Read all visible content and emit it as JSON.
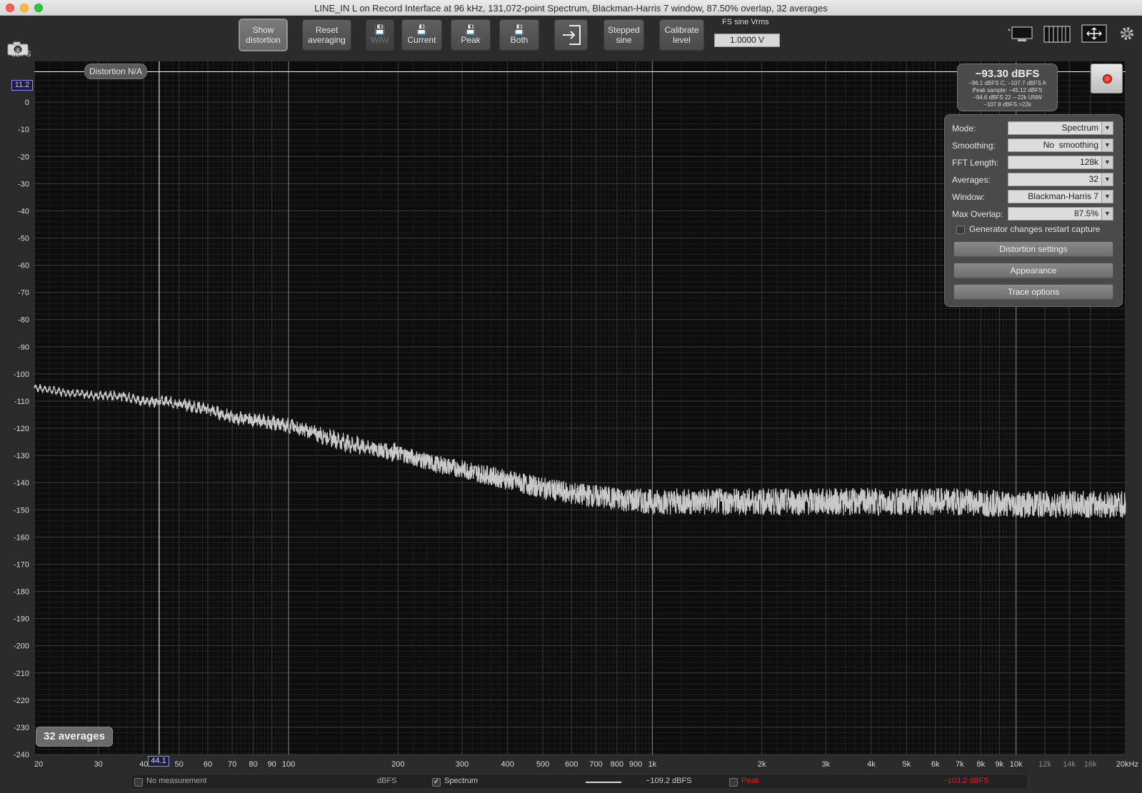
{
  "window": {
    "title": "LINE_IN L on Record Interface at 96 kHz, 131,072-point Spectrum, Blackman-Harris 7 window, 87.50% overlap, 32 averages"
  },
  "toolbar": {
    "show_distortion": [
      "Show",
      "distortion"
    ],
    "reset_averaging": [
      "Reset",
      "averaging"
    ],
    "wav_label": "WAV",
    "current_label": "Current",
    "peak_label": "Peak",
    "both_label": "Both",
    "stepped_sine": [
      "Stepped",
      "sine"
    ],
    "calibrate_level": [
      "Calibrate",
      "level"
    ],
    "fs_label": "FS sine Vrms",
    "fs_value": "1.0000 V",
    "icons": [
      "camera-icon",
      "save-icon",
      "import-icon",
      "single-view-icon",
      "multi-view-icon",
      "expand-icon",
      "gear-icon"
    ]
  },
  "axis": {
    "y_unit": "dBFS",
    "cursor_y": "11.2",
    "cursor_x": "44.1"
  },
  "badges": {
    "distortion": "Distortion N/A",
    "averages": "32 averages"
  },
  "level": {
    "main": "−93.30 dBFS",
    "lines": [
      "−96.1 dBFS C, −107.7 dBFS A",
      "Peak sample: −45.12 dBFS",
      "−94.6 dBFS 22 – 22k UNW",
      "−107.8 dBFS >22k"
    ]
  },
  "settings": {
    "rows": [
      {
        "label": "Mode:",
        "value": "Spectrum"
      },
      {
        "label": "Smoothing:",
        "value": "No  smoothing"
      },
      {
        "label": "FFT Length:",
        "value": "128k"
      },
      {
        "label": "Averages:",
        "value": "32"
      },
      {
        "label": "Window:",
        "value": "Blackman-Harris 7"
      },
      {
        "label": "Max Overlap:",
        "value": "87.5%"
      }
    ],
    "generator_label": "Generator changes restart capture",
    "generator_checked": false,
    "distortion_settings": "Distortion settings",
    "appearance": "Appearance",
    "trace_options": "Trace options"
  },
  "bottom": {
    "no_measurement": "No measurement",
    "unit": "dBFS",
    "spectrum_label": "Spectrum",
    "spectrum_checked": true,
    "spectrum_value": "−109.2 dBFS",
    "peak_label": "Peak",
    "peak_value": "−103.2 dBFS",
    "peak_color": "#e02020"
  },
  "chart_data": {
    "type": "line",
    "x_scale": "log",
    "xlim": [
      20,
      20000
    ],
    "ylim": [
      -240,
      15
    ],
    "ylabel": "dBFS",
    "y_ticks": [
      0,
      -10,
      -20,
      -30,
      -40,
      -50,
      -60,
      -70,
      -80,
      -90,
      -100,
      -110,
      -120,
      -130,
      -140,
      -150,
      -160,
      -170,
      -180,
      -190,
      -200,
      -210,
      -220,
      -230,
      -240
    ],
    "x_tick_labels": [
      "20",
      "30",
      "40",
      "50",
      "60",
      "70",
      "80",
      "90",
      "100",
      "200",
      "300",
      "400",
      "500",
      "600",
      "700",
      "800",
      "900",
      "1k",
      "2k",
      "3k",
      "4k",
      "5k",
      "6k",
      "7k",
      "8k",
      "9k",
      "10k",
      "12k",
      "14k",
      "16k",
      "20kHz"
    ],
    "x_tick_values": [
      20,
      30,
      40,
      50,
      60,
      70,
      80,
      90,
      100,
      200,
      300,
      400,
      500,
      600,
      700,
      800,
      900,
      1000,
      2000,
      3000,
      4000,
      5000,
      6000,
      7000,
      8000,
      9000,
      10000,
      12000,
      14000,
      16000,
      20000
    ],
    "cursor": {
      "x": 44.1,
      "y": 11.2
    },
    "series": [
      {
        "name": "Spectrum",
        "color": "#c8c8c8",
        "x": [
          20,
          25,
          30,
          35,
          40,
          45,
          50,
          60,
          70,
          80,
          90,
          100,
          120,
          150,
          200,
          250,
          300,
          400,
          500,
          600,
          700,
          800,
          1000,
          1500,
          2000,
          3000,
          5000,
          7000,
          10000,
          15000,
          20000
        ],
        "y": [
          -105,
          -107,
          -108,
          -108,
          -110,
          -110,
          -111,
          -113,
          -116,
          -117,
          -118,
          -119,
          -122,
          -126,
          -129,
          -133,
          -135,
          -139,
          -142,
          -144,
          -145,
          -146,
          -147,
          -147,
          -147,
          -147,
          -147,
          -147,
          -148,
          -148,
          -148
        ],
        "noise_band": 5
      }
    ]
  }
}
